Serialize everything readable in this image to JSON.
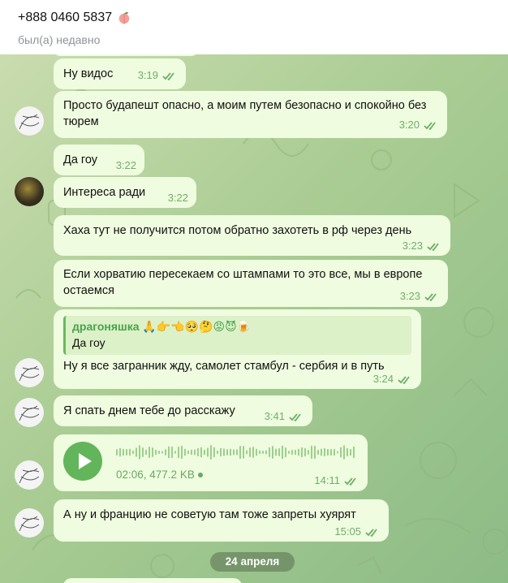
{
  "header": {
    "title": "+888 0460 5837",
    "status": "был(а) недавно",
    "emoji_icon": "peach-icon"
  },
  "colors": {
    "bubble": "#effcdf",
    "time": "#6eae6b",
    "accent": "#62b55b",
    "wallpaper": "#a9cc93"
  },
  "messages": [
    {
      "text": "Ну видос",
      "time": "3:19",
      "read": true
    },
    {
      "text": "Просто будапешт опасно, а моим путем безопасно и спокойно без тюрем",
      "time": "3:20",
      "read": true
    },
    {
      "text": "Да гоу",
      "time": "3:22",
      "read": false
    },
    {
      "text": "Интереса ради",
      "time": "3:22",
      "read": false
    },
    {
      "text": "Хаха тут не получится потом обратно захотеть в рф через день",
      "time": "3:23",
      "read": true
    },
    {
      "text": "Если хорватию пересекаем со штампами то это все, мы в европе остаемся",
      "time": "3:23",
      "read": true
    },
    {
      "reply_name": "драгоняшка 🙏👉👈🥺🤔😡😈🍺",
      "reply_text": "Да гоу",
      "text": "Ну я все загранник жду, самолет стамбул - сербия и в путь",
      "time": "3:24",
      "read": true
    },
    {
      "text": "Я спать днем тебе до расскажу",
      "time": "3:41",
      "read": true
    },
    {
      "voice_duration": "02:06, 477.2 KB",
      "time": "14:11",
      "read": true
    },
    {
      "text": "А ну и францию не советую там тоже запреты хуярят",
      "time": "15:05",
      "read": true
    }
  ],
  "date_divider": "24 апреля"
}
